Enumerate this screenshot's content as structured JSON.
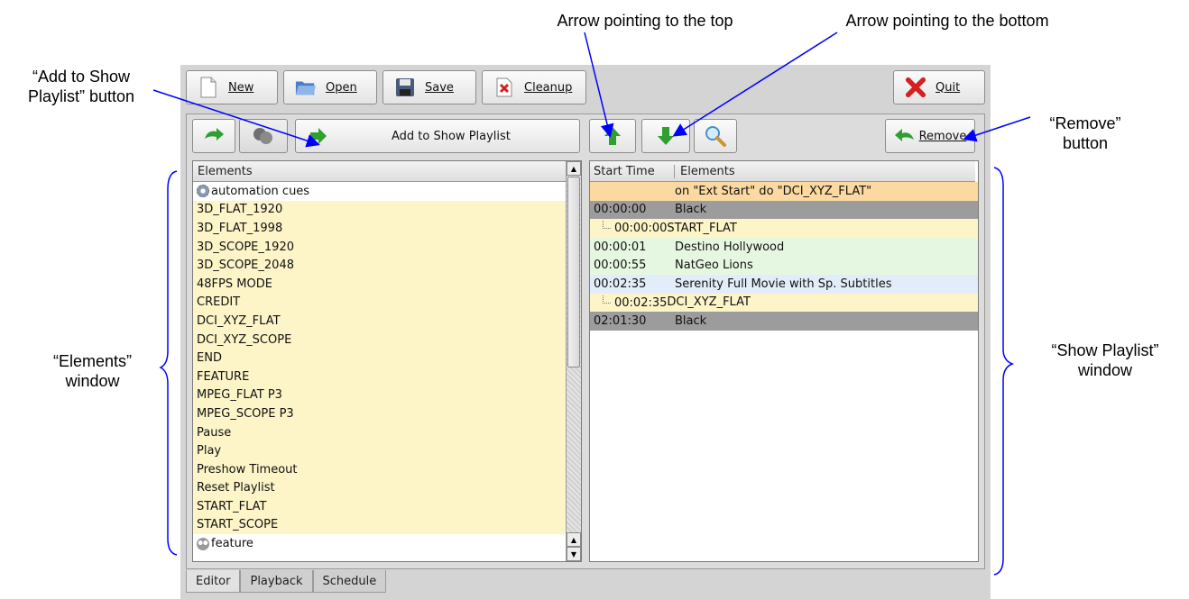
{
  "annotations": {
    "add_btn": [
      "“Add to Show",
      "Playlist” button"
    ],
    "arrow_top": "Arrow pointing to the top",
    "arrow_bottom": "Arrow pointing to the bottom",
    "remove_btn": [
      "“Remove”",
      "button"
    ],
    "elements_window": [
      "“Elements”",
      "window"
    ],
    "show_playlist_window": [
      "“Show Playlist”",
      "window"
    ]
  },
  "toolbar": {
    "new_label": "New",
    "open_label": "Open",
    "save_label": "Save",
    "cleanup_label": "Cleanup",
    "quit_label": "Quit"
  },
  "editor": {
    "add_label": "Add to Show Playlist",
    "remove_label": "Remove"
  },
  "elements": {
    "header": "Elements",
    "items": [
      {
        "label": "automation cues",
        "style": "white",
        "icon": "gear"
      },
      {
        "label": "3D_FLAT_1920",
        "style": "yellow"
      },
      {
        "label": "3D_FLAT_1998",
        "style": "yellow"
      },
      {
        "label": "3D_SCOPE_1920",
        "style": "yellow"
      },
      {
        "label": "3D_SCOPE_2048",
        "style": "yellow"
      },
      {
        "label": "48FPS MODE",
        "style": "yellow"
      },
      {
        "label": "CREDIT",
        "style": "yellow"
      },
      {
        "label": "DCI_XYZ_FLAT",
        "style": "yellow"
      },
      {
        "label": "DCI_XYZ_SCOPE",
        "style": "yellow"
      },
      {
        "label": "END",
        "style": "yellow"
      },
      {
        "label": "FEATURE",
        "style": "yellow"
      },
      {
        "label": "MPEG_FLAT P3",
        "style": "yellow"
      },
      {
        "label": "MPEG_SCOPE P3",
        "style": "yellow"
      },
      {
        "label": "Pause",
        "style": "yellow"
      },
      {
        "label": "Play",
        "style": "yellow"
      },
      {
        "label": "Preshow Timeout",
        "style": "yellow"
      },
      {
        "label": "Reset Playlist",
        "style": "yellow"
      },
      {
        "label": "START_FLAT",
        "style": "yellow"
      },
      {
        "label": "START_SCOPE",
        "style": "yellow"
      },
      {
        "label": "feature",
        "style": "white",
        "icon": "reel"
      }
    ]
  },
  "playlist": {
    "col_start": "Start Time",
    "col_elements": "Elements",
    "rows": [
      {
        "time": "",
        "element": "on \"Ext Start\" do \"DCI_XYZ_FLAT\"",
        "style": "orange",
        "indent": false
      },
      {
        "time": "00:00:00",
        "element": "Black",
        "style": "grey",
        "indent": false
      },
      {
        "time": "00:00:00",
        "element": "START_FLAT",
        "style": "yellow",
        "indent": true
      },
      {
        "time": "00:00:01",
        "element": "Destino Hollywood",
        "style": "green",
        "indent": false
      },
      {
        "time": "00:00:55",
        "element": "NatGeo Lions",
        "style": "green",
        "indent": false
      },
      {
        "time": "00:02:35",
        "element": "Serenity Full Movie with Sp. Subtitles",
        "style": "blue",
        "indent": false
      },
      {
        "time": "00:02:35",
        "element": "DCI_XYZ_FLAT",
        "style": "yellow",
        "indent": true
      },
      {
        "time": "02:01:30",
        "element": "Black",
        "style": "grey",
        "indent": false
      }
    ]
  },
  "tabs": [
    "Editor",
    "Playback",
    "Schedule"
  ],
  "colors": {
    "annotation_arrow": "#0000ff",
    "green_arrow": "#2ea02e",
    "quit_red": "#d62020"
  }
}
